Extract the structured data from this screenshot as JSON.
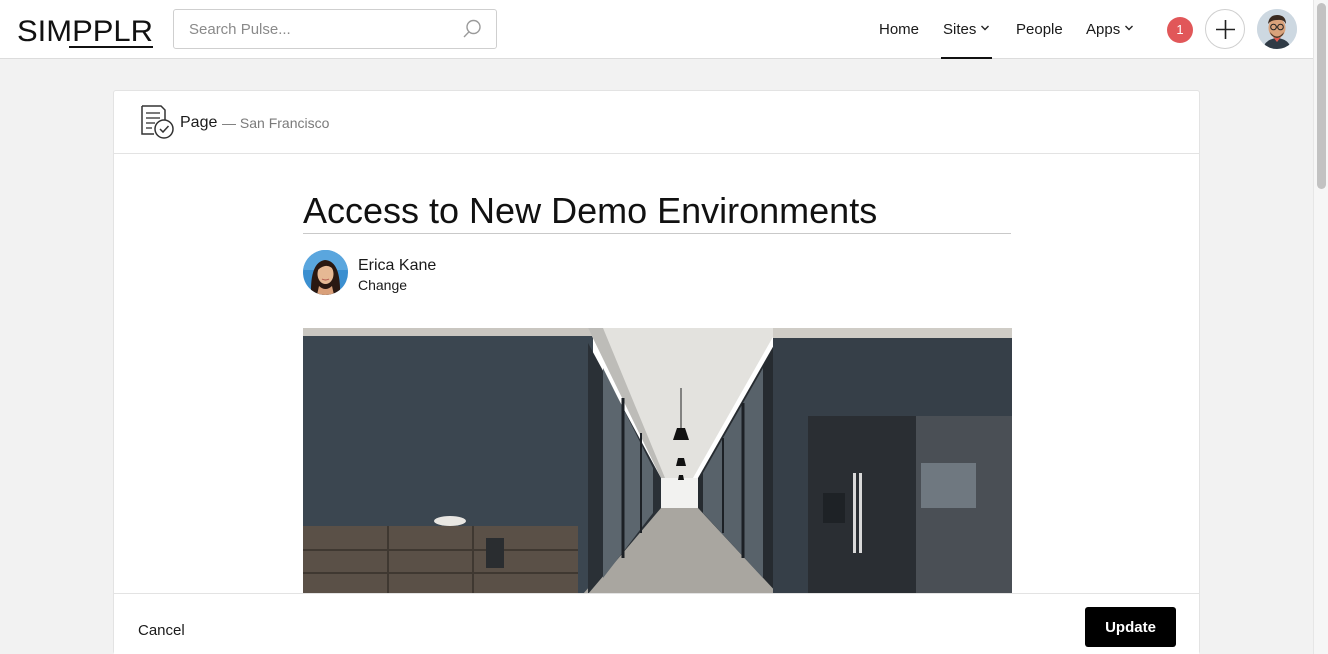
{
  "header": {
    "logo_text": "SIMPPLR",
    "search": {
      "placeholder": "Search Pulse...",
      "value": ""
    },
    "nav": [
      {
        "label": "Home",
        "dropdown": false,
        "active": false
      },
      {
        "label": "Sites",
        "dropdown": true,
        "active": true
      },
      {
        "label": "People",
        "dropdown": false,
        "active": false
      },
      {
        "label": "Apps",
        "dropdown": true,
        "active": false
      }
    ],
    "notification_count": "1"
  },
  "card": {
    "content_type": "Page",
    "site": "— San Francisco",
    "title": "Access to New Demo Environments",
    "author": {
      "name": "Erica Kane",
      "change_label": "Change"
    },
    "footer": {
      "cancel_label": "Cancel",
      "update_label": "Update"
    }
  },
  "colors": {
    "badge": "#e15759",
    "primary_button": "#000000"
  }
}
